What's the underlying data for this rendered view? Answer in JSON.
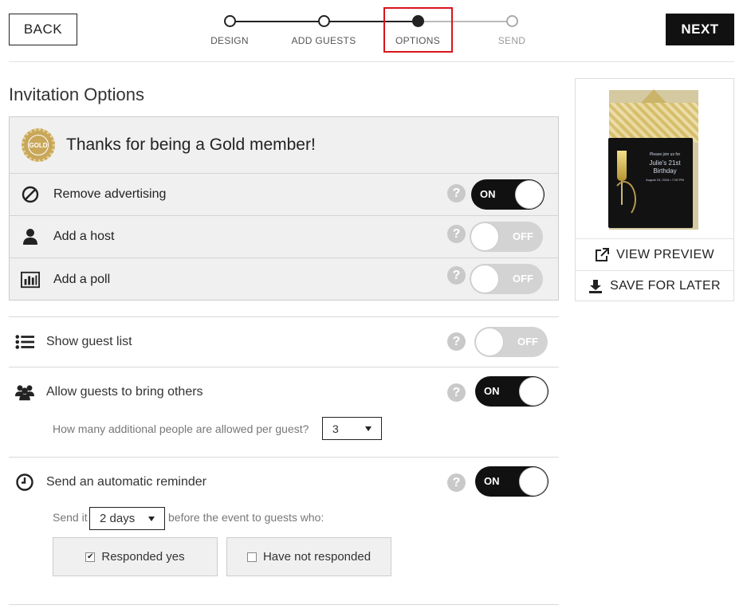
{
  "header": {
    "back_label": "BACK",
    "next_label": "NEXT",
    "steps": [
      {
        "label": "DESIGN",
        "state": "done"
      },
      {
        "label": "ADD GUESTS",
        "state": "done"
      },
      {
        "label": "OPTIONS",
        "state": "active"
      },
      {
        "label": "SEND",
        "state": "upcoming"
      }
    ]
  },
  "page_title": "Invitation Options",
  "gold": {
    "badge_text": "GOLD",
    "title": "Thanks for being a Gold member!",
    "options": [
      {
        "label": "Remove advertising",
        "icon": "no-ads-icon",
        "toggle": "ON"
      },
      {
        "label": "Add a host",
        "icon": "person-icon",
        "toggle": "OFF"
      },
      {
        "label": "Add a poll",
        "icon": "bar-chart-icon",
        "toggle": "OFF"
      }
    ]
  },
  "options": {
    "guest_list": {
      "label": "Show guest list",
      "icon": "list-icon",
      "toggle": "OFF"
    },
    "bring_others": {
      "label": "Allow guests to bring others",
      "icon": "group-icon",
      "toggle": "ON",
      "sub_label": "How many additional people are allowed per guest?",
      "selected": "3"
    },
    "reminder": {
      "label": "Send an automatic reminder",
      "icon": "clock-icon",
      "toggle": "ON",
      "send_prefix": "Send it",
      "selected": "2 days",
      "send_suffix": "before the event to guests who:",
      "checkboxes": [
        {
          "label": "Responded yes",
          "checked": true
        },
        {
          "label": "Have not responded",
          "checked": false
        }
      ]
    }
  },
  "help_glyph": "?",
  "preview": {
    "card_line1": "Please join us for",
    "card_line2": "Julie's 21st Birthday",
    "card_line3": "August 19, 2016 • 7:00 PM",
    "view_label": "VIEW PREVIEW",
    "save_label": "SAVE FOR LATER"
  },
  "colors": {
    "accent": "#111111",
    "highlight": "#d9141c",
    "gold": "#c8a75a"
  }
}
